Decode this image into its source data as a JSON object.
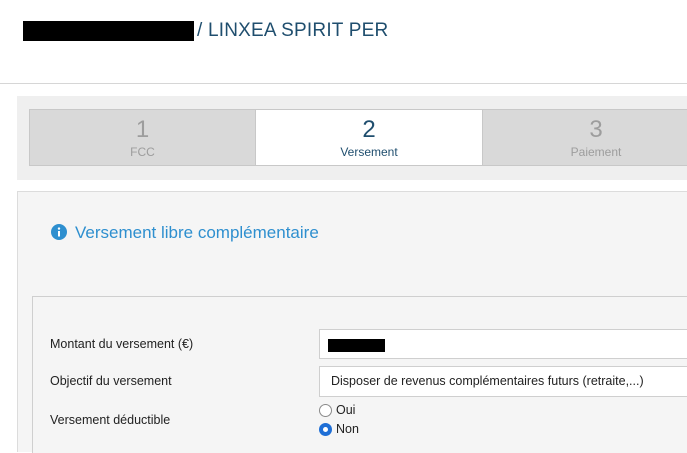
{
  "header": {
    "title": "/ LINXEA SPIRIT PER"
  },
  "steps": [
    {
      "number": "1",
      "label": "FCC",
      "active": false
    },
    {
      "number": "2",
      "label": "Versement",
      "active": true
    },
    {
      "number": "3",
      "label": "Paiement",
      "active": false
    }
  ],
  "section": {
    "title": "Versement libre complémentaire",
    "icon": "info-circle-icon"
  },
  "form": {
    "amount_label": "Montant du versement (€)",
    "objective_label": "Objectif du versement",
    "objective_value": "Disposer de revenus complémentaires futurs (retraite,...)",
    "deductible_label": "Versement déductible",
    "deductible_options": [
      {
        "label": "Oui",
        "checked": false
      },
      {
        "label": "Non",
        "checked": true
      }
    ]
  },
  "colors": {
    "brand_dark": "#1f4e6e",
    "accent_blue": "#2e8fcf",
    "radio_selected": "#1f6fd6"
  }
}
